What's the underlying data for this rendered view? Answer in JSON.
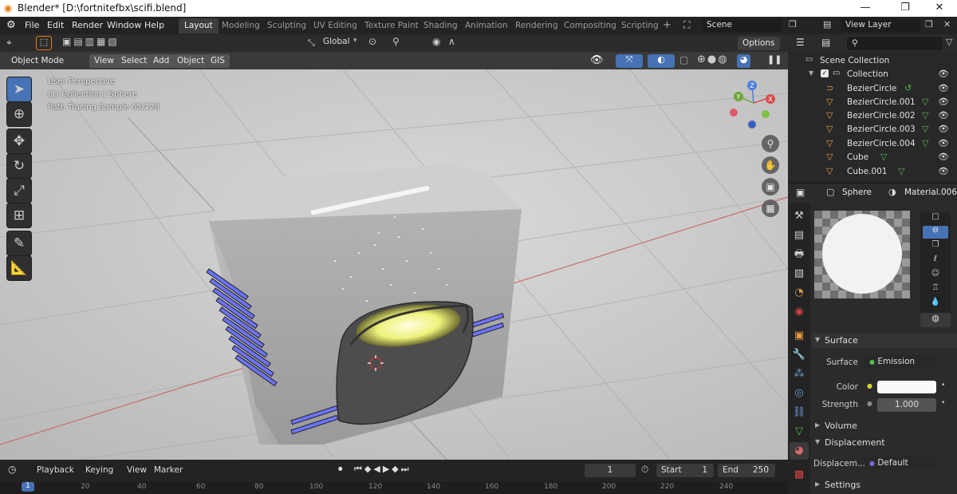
{
  "window": {
    "title": "Blender* [D:\\fortnitefbx\\scifi.blend]",
    "minimize": "—",
    "maximize": "❐",
    "close": "✕"
  },
  "menu": [
    "File",
    "Edit",
    "Render",
    "Window",
    "Help"
  ],
  "workspaces": [
    "Layout",
    "Modeling",
    "Sculpting",
    "UV Editing",
    "Texture Paint",
    "Shading",
    "Animation",
    "Rendering",
    "Compositing",
    "Scripting"
  ],
  "active_workspace": "Layout",
  "scene": {
    "name": "Scene",
    "view_layer": "View Layer"
  },
  "tool_header": {
    "orientation": "Global",
    "options": "Options"
  },
  "viewport_header": {
    "mode": "Object Mode",
    "view": "View",
    "select": "Select",
    "add": "Add",
    "object": "Object",
    "gis": "GIS"
  },
  "overlay": {
    "line1": "User Perspective",
    "line2": "(1) Collection | Sphere",
    "line3": "Path Tracing Sample 65/128"
  },
  "gizmo": {
    "x": "X",
    "y": "Y",
    "z": "Z"
  },
  "outliner": {
    "root": "Scene Collection",
    "collection": "Collection",
    "items": [
      "BezierCircle",
      "BezierCircle.001",
      "BezierCircle.002",
      "BezierCircle.003",
      "BezierCircle.004",
      "Cube",
      "Cube.001"
    ]
  },
  "properties": {
    "object": "Sphere",
    "material": "Material.006",
    "surface_section": "Surface",
    "surface_label": "Surface",
    "surface_value": "Emission",
    "color_label": "Color",
    "strength_label": "Strength",
    "strength_value": "1.000",
    "volume_section": "Volume",
    "displacement_section": "Displacement",
    "displacement_label": "Displacem...",
    "displacement_value": "Default",
    "settings_section": "Settings"
  },
  "timeline": {
    "playback": "Playback",
    "keying": "Keying",
    "view": "View",
    "marker": "Marker",
    "current_frame": "1",
    "start_label": "Start",
    "start": "1",
    "end_label": "End",
    "end": "250",
    "ticks": [
      "1",
      "20",
      "40",
      "60",
      "80",
      "100",
      "120",
      "140",
      "160",
      "180",
      "200",
      "220",
      "240"
    ]
  },
  "colors": {
    "accent": "#4772b3",
    "emission_glow": "#f4f7a0",
    "blue_light": "#6c73ff"
  }
}
